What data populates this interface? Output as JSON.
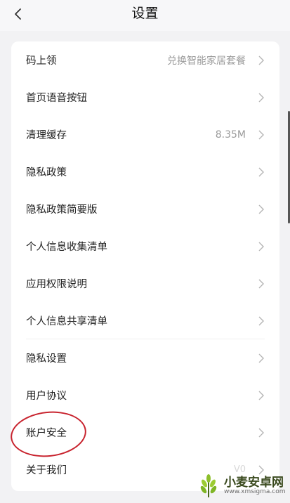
{
  "header": {
    "title": "设置",
    "back_icon": "chevron-left-icon"
  },
  "settings": [
    {
      "label": "码上领",
      "value": "兑换智能家居套餐"
    },
    {
      "label": "首页语音按钮",
      "value": ""
    },
    {
      "label": "清理缓存",
      "value": "8.35M"
    },
    {
      "label": "隐私政策",
      "value": ""
    },
    {
      "label": "隐私政策简要版",
      "value": ""
    },
    {
      "label": "个人信息收集清单",
      "value": ""
    },
    {
      "label": "应用权限说明",
      "value": ""
    },
    {
      "label": "个人信息共享清单",
      "value": ""
    },
    {
      "label": "隐私设置",
      "value": ""
    },
    {
      "label": "用户协议",
      "value": ""
    },
    {
      "label": "账户安全",
      "value": ""
    },
    {
      "label": "关于我们",
      "value": "V0"
    }
  ],
  "annotation": {
    "color": "#c8232e",
    "target": "账户安全"
  },
  "watermark": {
    "name": "小麦安卓网",
    "url": "www.xmsigma.com"
  },
  "colors": {
    "background": "#f2f2f4",
    "card": "#ffffff",
    "secondary_text": "#9a9a9a"
  }
}
